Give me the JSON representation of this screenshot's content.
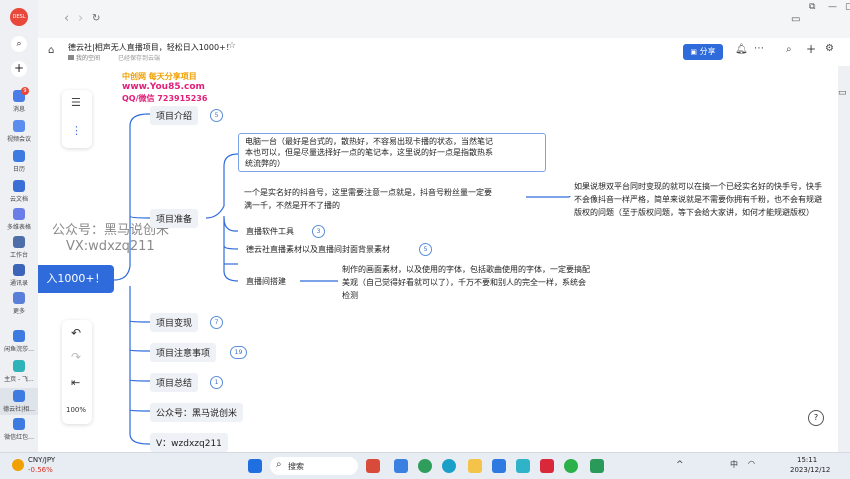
{
  "rail": {
    "avatar_text": "DESL",
    "messages_badge": "9",
    "items": [
      "消息",
      "视频会议",
      "日历",
      "云文档",
      "多维表格",
      "工作台",
      "通讯录",
      "更多",
      "闲鱼浣莎...",
      "主页 - 飞...",
      "德云社|相...",
      "微信红包..."
    ]
  },
  "browser": {
    "nav": {
      "back": "‹",
      "forward": "›",
      "refresh": "↻"
    },
    "window_icons": [
      "▭",
      "⧉",
      "—",
      "▢",
      "✕"
    ]
  },
  "doc": {
    "title": "德云社|相声无人直播项目，轻松日入1000+！",
    "breadcrumb_space": "我的空间",
    "saved_status": "已经保存到云端",
    "share_label": "分享"
  },
  "watermarks": {
    "site_line1": "中创网 每天分享项目",
    "site_line2": "www.You85.com",
    "site_line3": "QQ/微信 723915236",
    "gzh_line1": "公众号：黑马说创米",
    "gzh_line2": "VX:wdxzq211"
  },
  "mindmap": {
    "root": "入1000+！",
    "branches": [
      {
        "label": "项目介绍",
        "count": "5"
      },
      {
        "label": "项目准备",
        "count": ""
      },
      {
        "label": "项目变现",
        "count": "7"
      },
      {
        "label": "项目注意事项",
        "count": "19"
      },
      {
        "label": "项目总结",
        "count": "1"
      },
      {
        "label": "公众号：黑马说创米",
        "count": ""
      },
      {
        "label": "V：wzdxzq211",
        "count": ""
      }
    ],
    "prep_children": {
      "computer_lines": [
        "电脑一台（最好是台式的，散热好，不容易出现卡播的状态，当然笔记",
        "本也可以，但是尽量选择好一点的笔记本，这里说的好一点是指散热系",
        "统流弊的）"
      ],
      "account_lines": [
        "一个是实名好的抖音号，这里需要注意一点就是，抖音号粉丝量一定要",
        "满一千，不然是开不了播的"
      ],
      "account_detail_lines": [
        "如果说想双平台同时变现的就可以在搞一个已经实名好的快手号，快手",
        "不会像抖音一样严格，简单来说就是不需要你拥有千粉，也不会有规避",
        "版权的问题（至于版权问题，等下会给大家讲，如何才能规避版权）"
      ],
      "tools": {
        "label": "直播软件工具",
        "count": "3"
      },
      "materials": {
        "label": "德云社直播素材以及直播间封面背景素材",
        "count": "5"
      },
      "setup": {
        "label": "直播间搭建"
      },
      "setup_lines": [
        "制作的画面素材，以及使用的字体，包括歌曲使用的字体，一定要搞配",
        "美观（自己觉得好看就可以了），千万不要和别人的完全一样，系统会",
        "检测"
      ]
    }
  },
  "tools_panel": {
    "zoom": "100%",
    "undo": "↶",
    "redo": "↷",
    "collapse": "⇤"
  },
  "taskbar": {
    "ticker_name": "CNY/JPY",
    "ticker_change": "-0.56%",
    "search_placeholder": "搜索",
    "ime": "中",
    "time": "15:11",
    "date": "2023/12/12",
    "tray_arrow": "^"
  }
}
